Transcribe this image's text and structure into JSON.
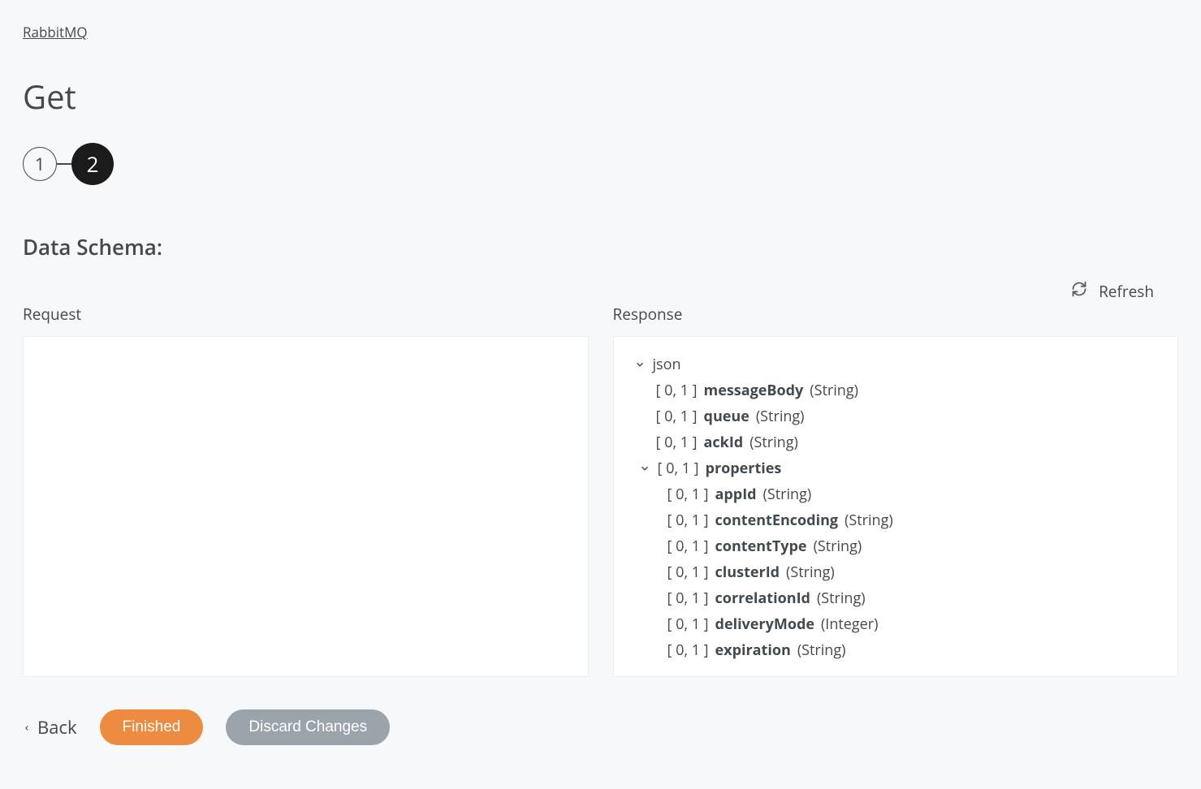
{
  "breadcrumb": "RabbitMQ",
  "title": "Get",
  "stepper": {
    "step1": "1",
    "step2": "2"
  },
  "sectionTitle": "Data Schema:",
  "refreshLabel": "Refresh",
  "panels": {
    "requestLabel": "Request",
    "responseLabel": "Response"
  },
  "tree": {
    "root": "json",
    "cardinality": "[ 0, 1 ]",
    "items": [
      {
        "name": "messageBody",
        "type": "(String)"
      },
      {
        "name": "queue",
        "type": "(String)"
      },
      {
        "name": "ackId",
        "type": "(String)"
      }
    ],
    "props": {
      "name": "properties",
      "items": [
        {
          "name": "appId",
          "type": "(String)"
        },
        {
          "name": "contentEncoding",
          "type": "(String)"
        },
        {
          "name": "contentType",
          "type": "(String)"
        },
        {
          "name": "clusterId",
          "type": "(String)"
        },
        {
          "name": "correlationId",
          "type": "(String)"
        },
        {
          "name": "deliveryMode",
          "type": "(Integer)"
        },
        {
          "name": "expiration",
          "type": "(String)"
        }
      ]
    }
  },
  "footer": {
    "back": "Back",
    "finished": "Finished",
    "discard": "Discard Changes"
  }
}
